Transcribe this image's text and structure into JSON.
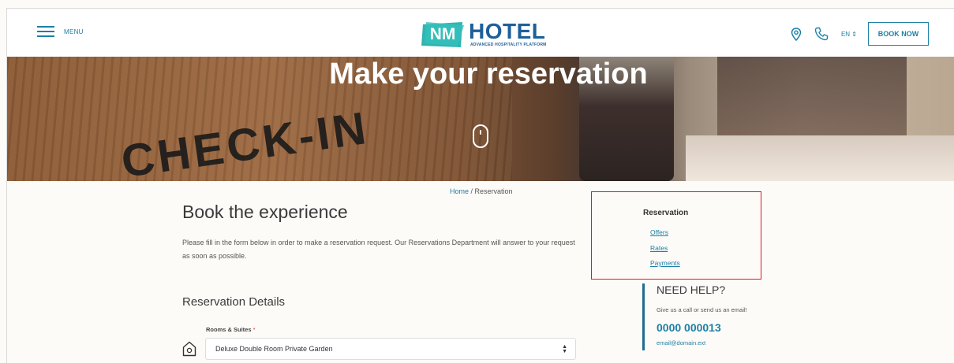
{
  "header": {
    "menu_label": "MENU",
    "logo": {
      "nm": "NM",
      "hotel": "HOTEL",
      "tagline": "ADVANCED HOSPITALITY PLATFORM"
    },
    "icons": [
      "map-pin-icon",
      "phone-icon"
    ],
    "language": "EN ⇕",
    "book_now": "BOOK NOW",
    "accent_color": "#1c80a5"
  },
  "hero": {
    "title": "Make your reservation",
    "sign_text": "CHECK-IN",
    "scroll_icon": "mouse-scroll-icon"
  },
  "breadcrumb": {
    "home": "Home",
    "separator": " / ",
    "current": "Reservation"
  },
  "main": {
    "title": "Book the experience",
    "intro": "Please fill in the form below in order to make a reservation request. Our Reservations Department will answer to your request as soon as possible.",
    "section_title": "Reservation Details",
    "rooms_field": {
      "label": "Rooms & Suites",
      "required_mark": "*",
      "value": "Deluxe Double Room Private Garden",
      "icon": "home-icon"
    }
  },
  "sidebar": {
    "title": "Reservation",
    "links": [
      "Offers",
      "Rates",
      "Payments"
    ],
    "highlight_color": "#e0161e"
  },
  "help": {
    "title": "NEED HELP?",
    "subtitle": "Give us a call or send us an email!",
    "phone": "0000 000013",
    "email": "email@domain.ext"
  }
}
